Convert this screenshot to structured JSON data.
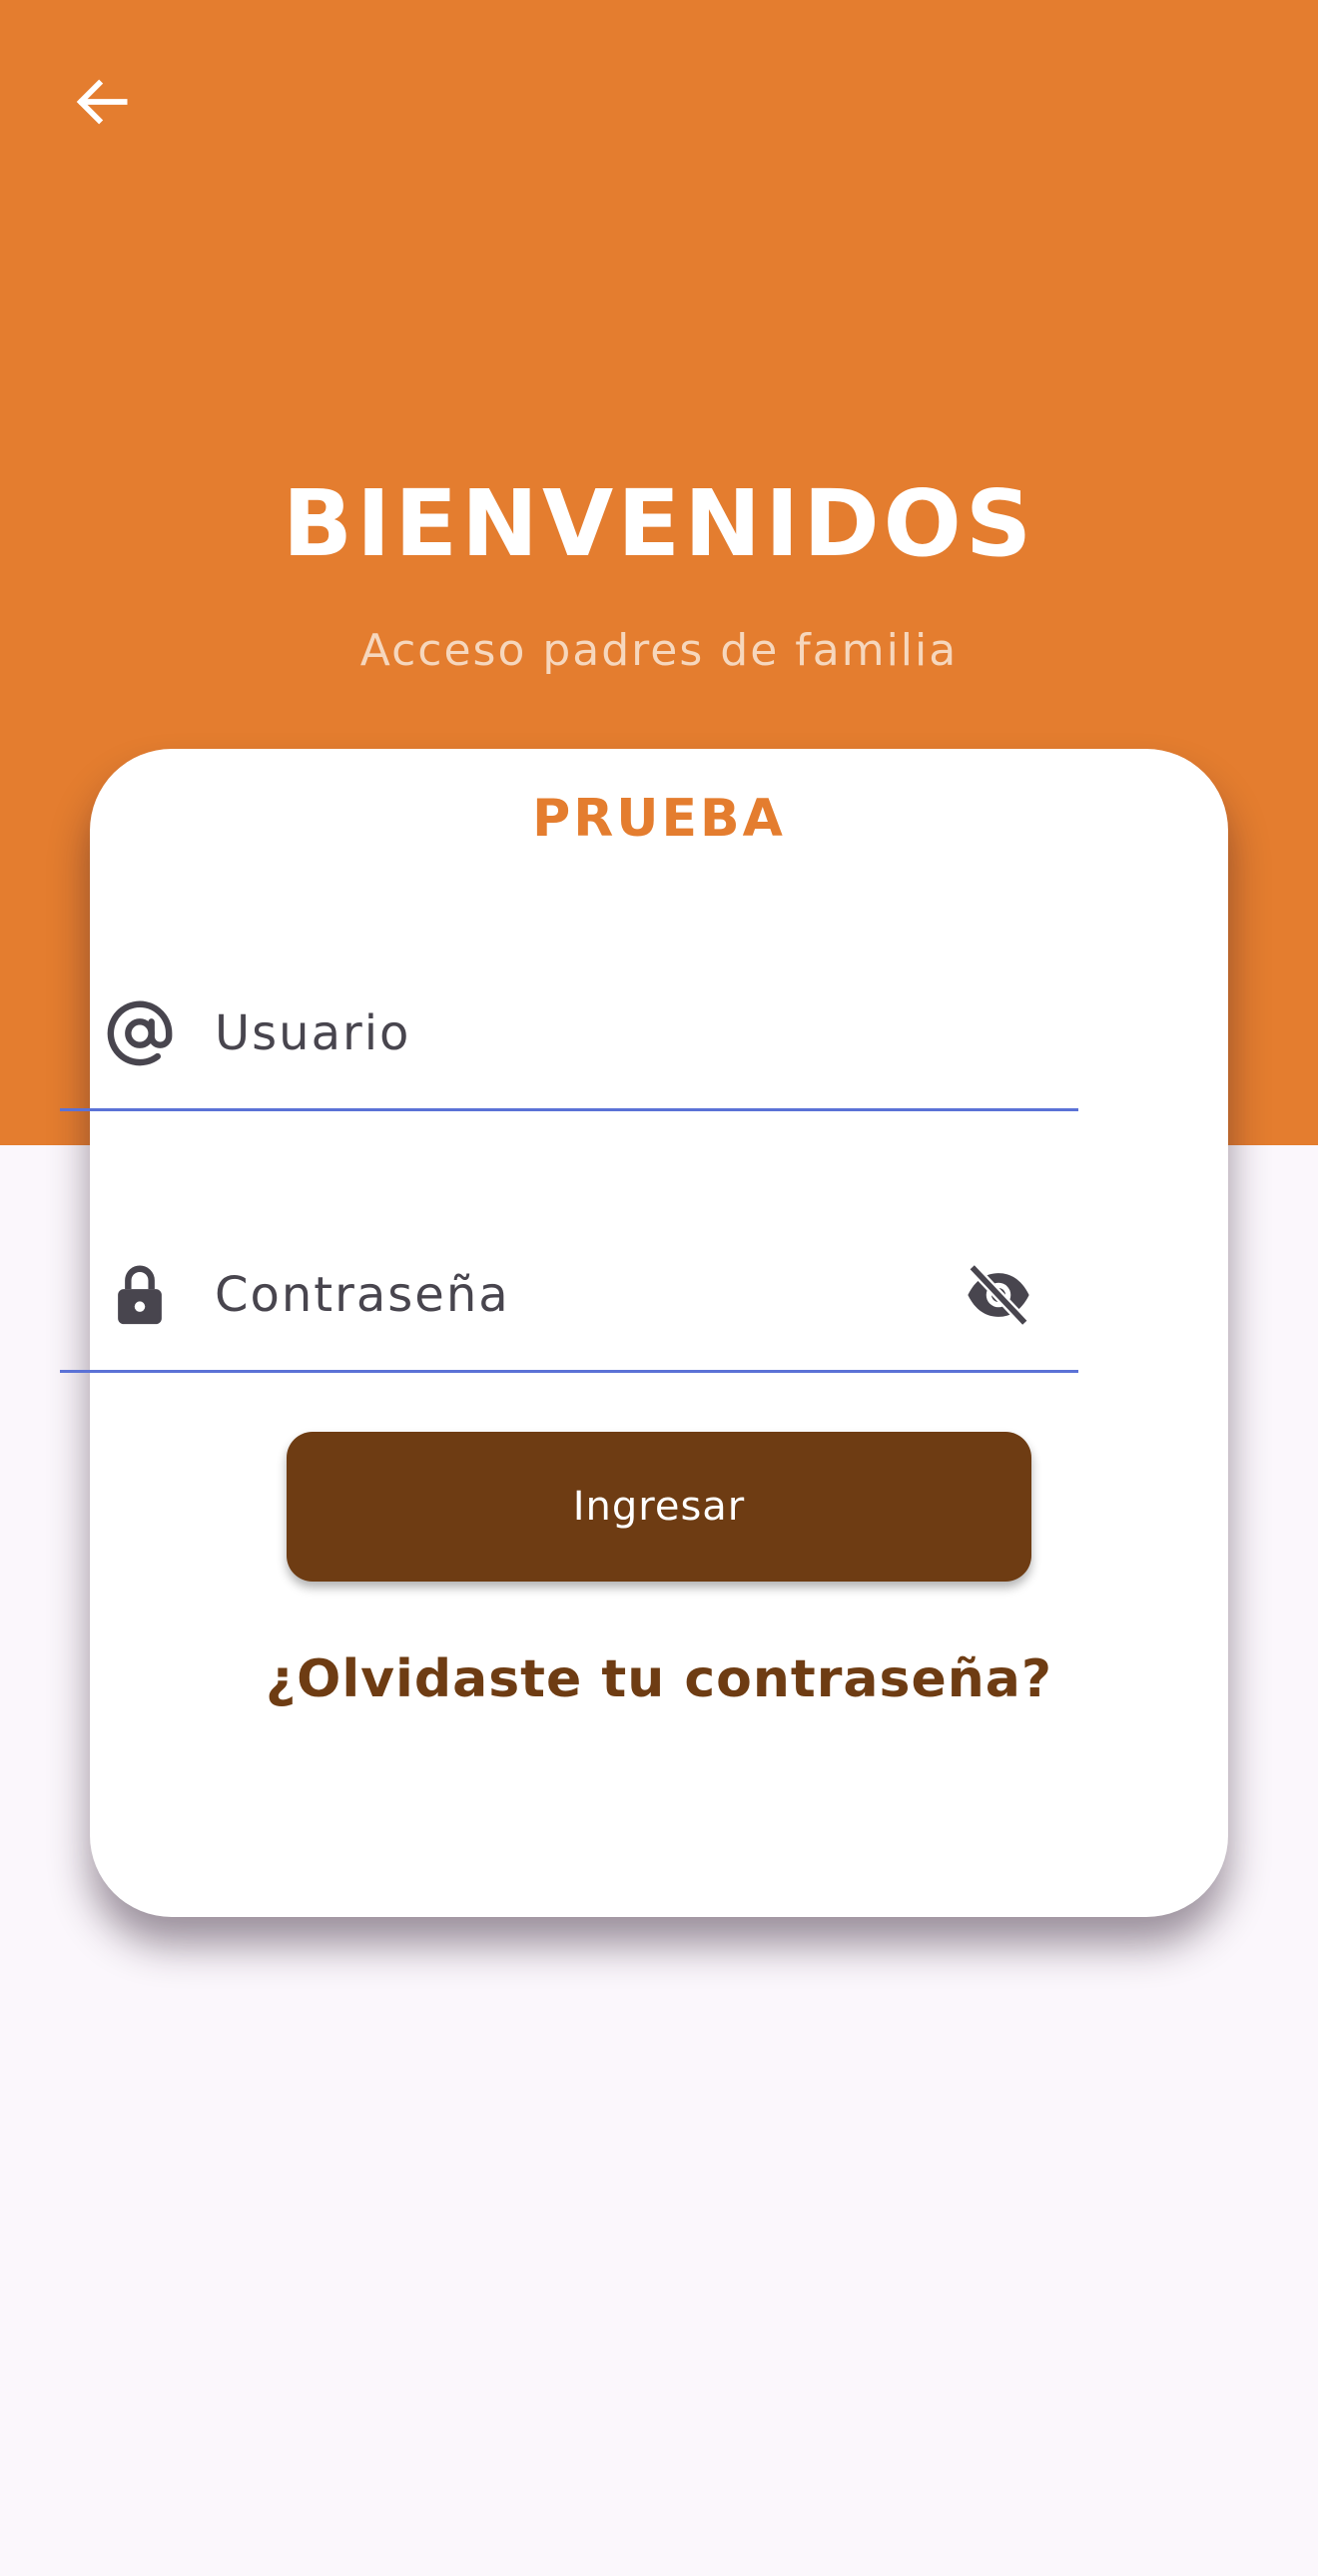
{
  "header": {
    "back_icon": "arrow-left-icon",
    "title": "BIENVENIDOS",
    "subtitle": "Acceso padres de familia",
    "background_color": "#e47d2f"
  },
  "card": {
    "title": "PRUEBA",
    "username": {
      "icon": "at-sign-icon",
      "placeholder": "Usuario",
      "value": ""
    },
    "password": {
      "icon": "lock-icon",
      "placeholder": "Contraseña",
      "value": "",
      "visibility_icon": "eye-off-icon"
    },
    "login_label": "Ingresar",
    "forgot_label": "¿Olvidaste tu contraseña?"
  },
  "colors": {
    "accent": "#e47d2f",
    "primary_brown": "#6e3c13",
    "field_underline": "#5b72d6",
    "page_background": "#fbf7fc"
  }
}
